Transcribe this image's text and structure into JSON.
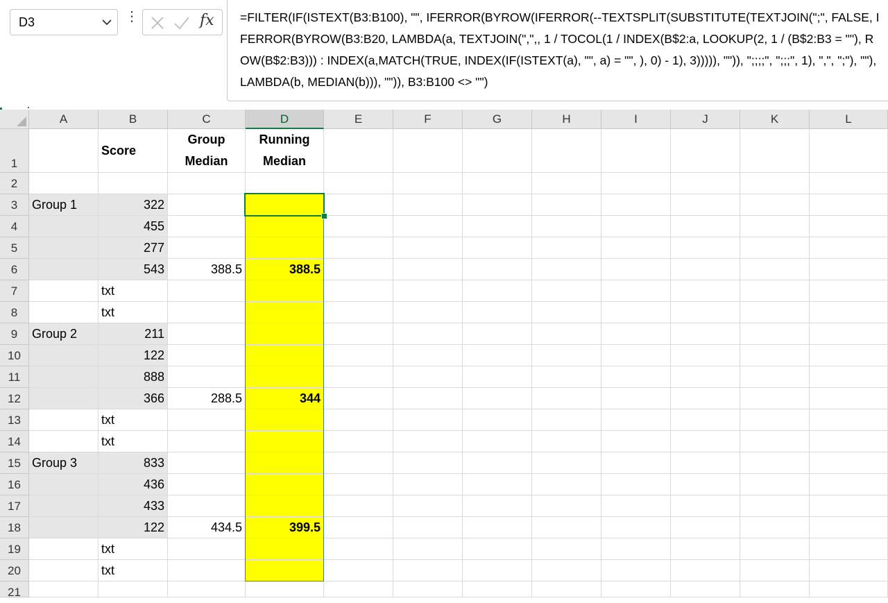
{
  "name_box": {
    "value": "D3"
  },
  "formula_bar": {
    "fx_label": "fx",
    "formula": "=FILTER(IF(ISTEXT(B3:B100), \"\", IFERROR(BYROW(IFERROR(--TEXTSPLIT(SUBSTITUTE(TEXTJOIN(\";\", FALSE, IFERROR(BYROW(B3:B20, LAMBDA(a, TEXTJOIN(\",\",, 1 / TOCOL(1 / INDEX(B$2:a, LOOKUP(2, 1 / (B$2:B3 = \"\"), ROW(B$2:B3))) : INDEX(a,MATCH(TRUE, INDEX(IF(ISTEXT(a), \"\", a) = \"\", ), 0) - 1), 3))))), \"\")), \";;;;\", \";;;\", 1), \",\", \";\"), \"\"), LAMBDA(b, MEDIAN(b))), \"\")), B3:B100 <> \"\")"
  },
  "columns": [
    "A",
    "B",
    "C",
    "D",
    "E",
    "F",
    "G",
    "H",
    "I",
    "J",
    "K",
    "L"
  ],
  "selected_column": "D",
  "headers": {
    "B": "Score",
    "C": "Group Median",
    "D": "Running Median"
  },
  "rows": [
    {
      "n": "1"
    },
    {
      "n": "2"
    },
    {
      "n": "3",
      "A": "Group 1",
      "B": "322",
      "C": "",
      "D": ""
    },
    {
      "n": "4",
      "B": "455"
    },
    {
      "n": "5",
      "B": "277"
    },
    {
      "n": "6",
      "B": "543",
      "C": "388.5",
      "D": "388.5"
    },
    {
      "n": "7",
      "B": "txt"
    },
    {
      "n": "8",
      "B": "txt"
    },
    {
      "n": "9",
      "A": "Group 2",
      "B": "211"
    },
    {
      "n": "10",
      "B": "122"
    },
    {
      "n": "11",
      "B": "888"
    },
    {
      "n": "12",
      "B": "366",
      "C": "288.5",
      "D": "344"
    },
    {
      "n": "13",
      "B": "txt"
    },
    {
      "n": "14",
      "B": "txt"
    },
    {
      "n": "15",
      "A": "Group 3",
      "B": "833"
    },
    {
      "n": "16",
      "B": "436"
    },
    {
      "n": "17",
      "B": "433"
    },
    {
      "n": "18",
      "B": "122",
      "C": "434.5",
      "D": "399.5"
    },
    {
      "n": "19",
      "B": "txt"
    },
    {
      "n": "20",
      "B": "txt"
    },
    {
      "n": "21"
    }
  ],
  "colors": {
    "accent": "#107c41",
    "highlight": "#ffff00",
    "group_fill": "#e6e6e6"
  }
}
